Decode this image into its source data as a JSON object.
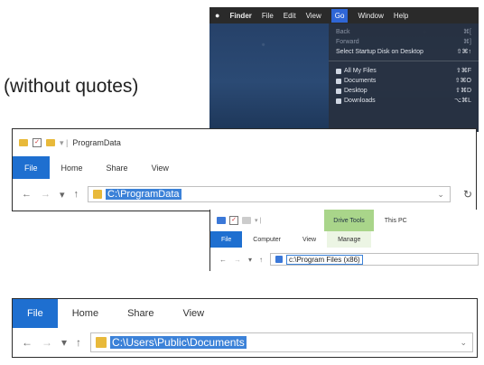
{
  "note": "(without quotes)",
  "mac": {
    "menubar": [
      "Finder",
      "File",
      "Edit",
      "View",
      "Go",
      "Window",
      "Help"
    ],
    "active_menu": "Go",
    "items_top": [
      {
        "label": "Back",
        "shortcut": "⌘[",
        "enabled": false
      },
      {
        "label": "Forward",
        "shortcut": "⌘]",
        "enabled": false
      },
      {
        "label": "Select Startup Disk on Desktop",
        "shortcut": "⇧⌘↑",
        "enabled": true
      }
    ],
    "items_places": [
      {
        "label": "All My Files",
        "shortcut": "⇧⌘F"
      },
      {
        "label": "Documents",
        "shortcut": "⇧⌘O"
      },
      {
        "label": "Desktop",
        "shortcut": "⇧⌘D"
      },
      {
        "label": "Downloads",
        "shortcut": "⌥⌘L"
      }
    ]
  },
  "win1": {
    "title": "ProgramData",
    "tabs": [
      "File",
      "Home",
      "Share",
      "View"
    ],
    "path": "C:\\ProgramData"
  },
  "win2": {
    "context_tab": "Drive Tools",
    "title": "This PC",
    "tabs": [
      "File",
      "Computer",
      "View",
      "Manage"
    ],
    "path": "c:\\Program Files (x86)"
  },
  "win3": {
    "tabs": [
      "File",
      "Home",
      "Share",
      "View"
    ],
    "path": "C:\\Users\\Public\\Documents"
  },
  "colors": {
    "file_tab": "#1e6fd0",
    "selection": "#3c82d8",
    "drive_tools": "#a9d58a"
  }
}
